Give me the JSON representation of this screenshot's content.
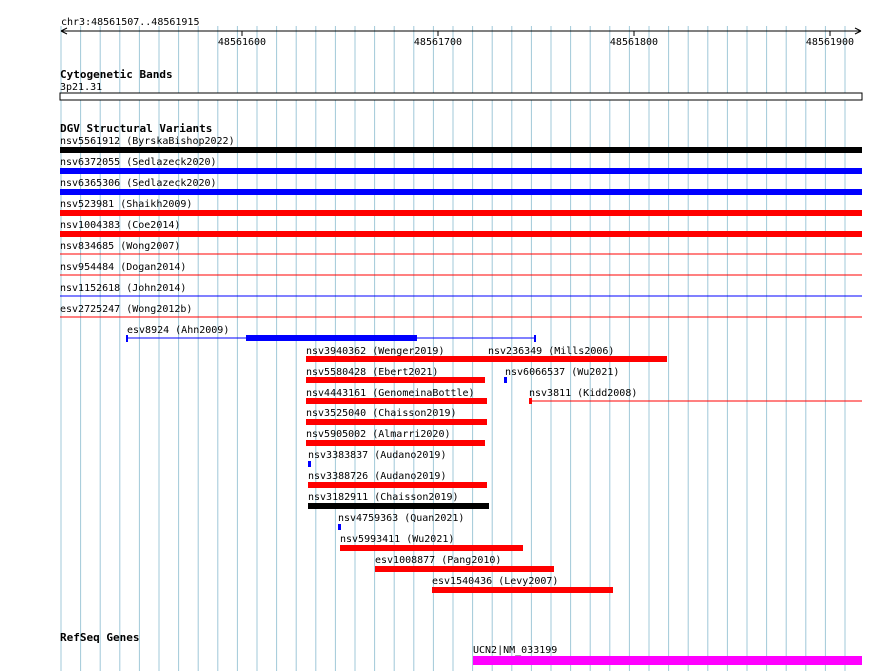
{
  "browser": {
    "locus": "chr3:48561507..48561915",
    "ruler_ticks": [
      "48561600",
      "48561700",
      "48561800",
      "48561900"
    ]
  },
  "tracks": {
    "cytoband": {
      "title": "Cytogenetic Bands",
      "band": "3p21.31"
    },
    "dgv": {
      "title": "DGV Structural Variants",
      "colors": {
        "loss": "#ff0000",
        "gain": "#0000ff",
        "complex": "#000000"
      },
      "features": [
        {
          "label": "nsv5561912 (ByrskaBishop2022)",
          "color": "#000000"
        },
        {
          "label": "nsv6372055 (Sedlazeck2020)",
          "color": "#0000ff"
        },
        {
          "label": "nsv6365306 (Sedlazeck2020)",
          "color": "#0000ff"
        },
        {
          "label": "nsv523981 (Shaikh2009)",
          "color": "#ff0000"
        },
        {
          "label": "nsv1004383 (Coe2014)",
          "color": "#ff0000"
        },
        {
          "label": "nsv834685 (Wong2007)",
          "color": "#ff0000"
        },
        {
          "label": "nsv954484 (Dogan2014)",
          "color": "#ff0000"
        },
        {
          "label": "nsv1152618 (John2014)",
          "color": "#0000ff"
        },
        {
          "label": "esv2725247 (Wong2012b)",
          "color": "#ff0000"
        },
        {
          "label": "esv8924 (Ahn2009)",
          "color": "#0000ff"
        },
        {
          "label": "nsv3940362 (Wenger2019)",
          "color": "#ff0000"
        },
        {
          "label": "nsv236349 (Mills2006)",
          "color": "#ff0000"
        },
        {
          "label": "nsv5580428 (Ebert2021)",
          "color": "#ff0000"
        },
        {
          "label": "nsv6066537 (Wu2021)",
          "color": "#0000ff"
        },
        {
          "label": "nsv4443161 (GenomeinaBottle)",
          "color": "#ff0000"
        },
        {
          "label": "nsv3811 (Kidd2008)",
          "color": "#ff0000"
        },
        {
          "label": "nsv3525040 (Chaisson2019)",
          "color": "#ff0000"
        },
        {
          "label": "nsv5905002 (Almarri2020)",
          "color": "#ff0000"
        },
        {
          "label": "nsv3383837 (Audano2019)",
          "color": "#0000ff"
        },
        {
          "label": "nsv3388726 (Audano2019)",
          "color": "#ff0000"
        },
        {
          "label": "nsv3182911 (Chaisson2019)",
          "color": "#000000"
        },
        {
          "label": "nsv4759363 (Quan2021)",
          "color": "#0000ff"
        },
        {
          "label": "nsv5993411 (Wu2021)",
          "color": "#ff0000"
        },
        {
          "label": "esv1008877 (Pang2010)",
          "color": "#ff0000"
        },
        {
          "label": "esv1540436 (Levy2007)",
          "color": "#ff0000"
        }
      ]
    },
    "refseq": {
      "title": "RefSeq Genes",
      "gene": {
        "label": "UCN2|NM_033199",
        "color": "#ff00ff"
      }
    }
  },
  "colors": {
    "grid": "#a0c8d8",
    "ruler": "#000000"
  }
}
